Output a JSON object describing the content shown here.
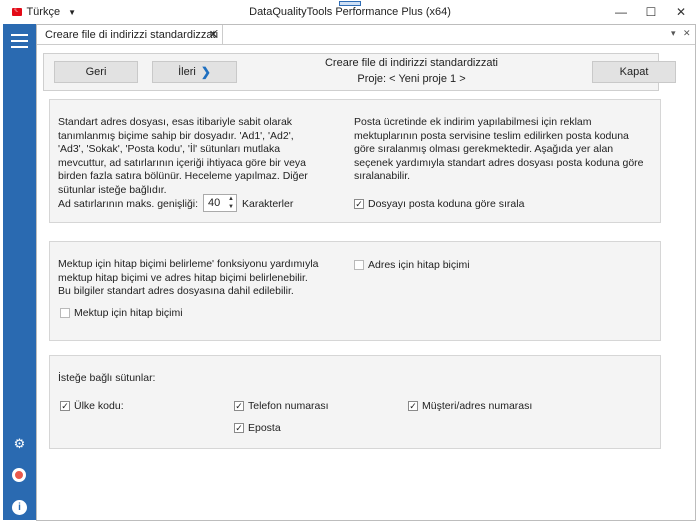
{
  "app": {
    "language": "Türkçe",
    "title": "DataQualityTools Performance Plus (x64)",
    "window_controls": {
      "minimize": "—",
      "maximize": "☐",
      "close": "✕"
    }
  },
  "sidebar": {
    "icons": [
      "hamburger-menu-icon",
      "gear-icon",
      "lifebuoy-icon",
      "info-icon"
    ]
  },
  "tab": {
    "label": "Creare file di indirizzi standardizzati",
    "close": "✕",
    "controls": {
      "dropdown": "▾",
      "close": "✕"
    }
  },
  "toolbar": {
    "back_label": "Geri",
    "forward_label": "İleri",
    "forward_chevron": "❯",
    "heading": "Creare file di indirizzi standardizzati",
    "project": "Proje: < Yeni proje 1 >",
    "close_label": "Kapat"
  },
  "panel1": {
    "left_text": "Standart adres dosyası, esas itibariyle sabit olarak tanımlanmış biçime sahip bir dosyadır. 'Ad1', 'Ad2', 'Ad3', 'Sokak', 'Posta kodu', 'İl' sütunları mutlaka mevcuttur, ad satırlarının içeriği ihtiyaca göre bir veya birden fazla satıra bölünür. Heceleme yapılmaz. Diğer sütunlar isteğe bağlıdır.",
    "right_text": "Posta ücretinde ek indirim yapılabilmesi için reklam mektuplarının posta servisine teslim edilirken posta koduna göre sıralanmış olması gerekmektedir. Aşağıda yer alan seçenek yardımıyla standart adres dosyası posta koduna göre sıralanabilir.",
    "width_label": "Ad satırlarının maks. genişliği:",
    "width_value": "40",
    "width_unit": "Karakterler",
    "sort_label": "Dosyayı posta koduna göre sırala",
    "sort_checked": true
  },
  "panel2": {
    "text": "Mektup için hitap biçimi belirleme' fonksiyonu yardımıyla mektup hitap biçimi ve adres hitap biçimi belirlenebilir. Bu bilgiler standart adres dosyasına dahil edilebilir.",
    "address_salutation_label": "Adres için hitap biçimi",
    "address_salutation_checked": false,
    "letter_salutation_label": "Mektup için hitap biçimi",
    "letter_salutation_checked": false
  },
  "panel3": {
    "title": "İsteğe bağlı sütunlar:",
    "options": [
      {
        "label": "Ülke kodu:",
        "checked": true
      },
      {
        "label": "Telefon numarası",
        "checked": true
      },
      {
        "label": "Müşteri/adres numarası",
        "checked": true
      },
      {
        "label": "Eposta",
        "checked": true
      }
    ]
  },
  "colors": {
    "sidebar": "#2a6ab1",
    "accent": "#1e6fc0",
    "panel_bg": "#f4f4f4",
    "button_bg": "#e2e2e2"
  }
}
